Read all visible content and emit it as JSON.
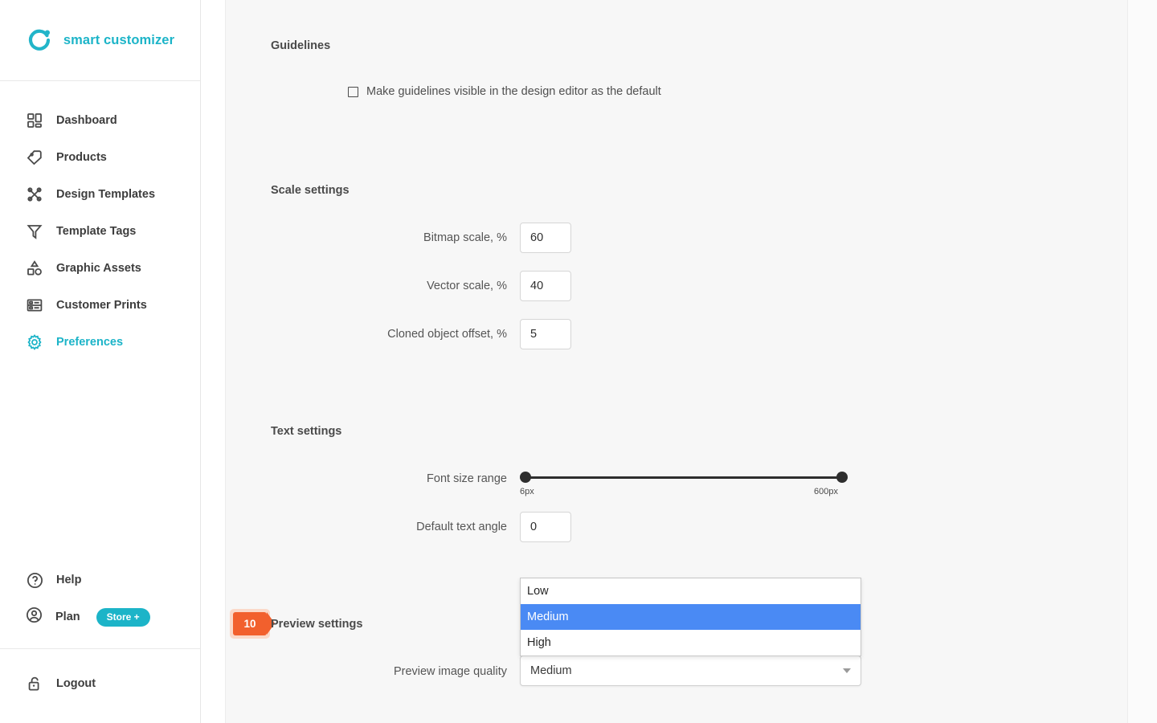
{
  "brand": {
    "name": "smart customizer",
    "accent_color": "#1cb4c8",
    "logo_icon": "circle-dot-logo-icon"
  },
  "sidebar": {
    "items": [
      {
        "label": "Dashboard",
        "icon": "grid-icon",
        "active": false
      },
      {
        "label": "Products",
        "icon": "tag-icon",
        "active": false
      },
      {
        "label": "Design Templates",
        "icon": "design-tools-icon",
        "active": false
      },
      {
        "label": "Template Tags",
        "icon": "funnel-icon",
        "active": false
      },
      {
        "label": "Graphic Assets",
        "icon": "shapes-icon",
        "active": false
      },
      {
        "label": "Customer Prints",
        "icon": "table-rows-icon",
        "active": false
      },
      {
        "label": "Preferences",
        "icon": "gear-icon",
        "active": true
      }
    ],
    "bottom": {
      "help_label": "Help",
      "help_icon": "question-circle-icon",
      "plan_label": "Plan",
      "plan_icon": "user-circle-icon",
      "plan_badge": "Store +",
      "plan_badge_color": "#1cb4c8",
      "logout_label": "Logout",
      "logout_icon": "unlock-icon"
    }
  },
  "main": {
    "guidelines": {
      "title": "Guidelines",
      "checkbox_label": "Make guidelines visible in the design editor as the default",
      "checkbox_checked": false
    },
    "scale_settings": {
      "title": "Scale settings",
      "fields": [
        {
          "label": "Bitmap scale, %",
          "value": "60"
        },
        {
          "label": "Vector scale, %",
          "value": "40"
        },
        {
          "label": "Cloned object offset, %",
          "value": "5"
        }
      ]
    },
    "text_settings": {
      "title": "Text settings",
      "font_size_range": {
        "label": "Font size range",
        "min_tick": "6px",
        "max_tick": "600px"
      },
      "default_text_angle": {
        "label": "Default text angle",
        "value": "0"
      }
    },
    "preview_settings": {
      "step_number": "10",
      "step_color": "#f2602d",
      "title": "Preview settings",
      "quality": {
        "label": "Preview image quality",
        "selected": "Medium",
        "options": [
          "Low",
          "Medium",
          "High"
        ],
        "highlight_color": "#4a8af4",
        "open": true
      }
    }
  },
  "support": {
    "chat_icon": "envelope-icon",
    "chat_color": "#18aec5"
  }
}
